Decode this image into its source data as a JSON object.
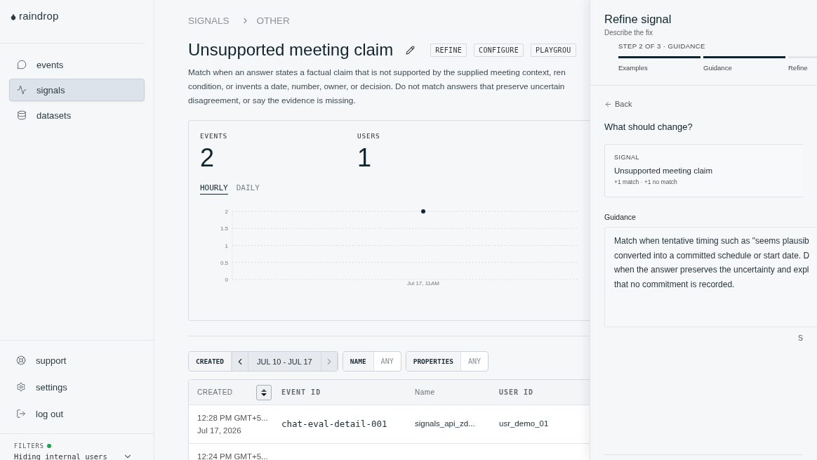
{
  "sidebar": {
    "logo": "raindrop",
    "nav": [
      {
        "label": "events",
        "selected": false
      },
      {
        "label": "signals",
        "selected": true
      },
      {
        "label": "datasets",
        "selected": false
      }
    ],
    "footer": [
      {
        "label": "support"
      },
      {
        "label": "settings"
      },
      {
        "label": "log out"
      }
    ],
    "filters": {
      "label": "FILTERS",
      "active": true,
      "value": "Hiding internal users"
    }
  },
  "breadcrumb": [
    "SIGNALS",
    "OTHER"
  ],
  "signal": {
    "title": "Unsupported meeting claim",
    "actions": [
      "REFINE",
      "CONFIGURE",
      "PLAYGROU"
    ],
    "description": [
      "Match when an answer states a factual claim that is not supported by the supplied meeting context, ren",
      "condition, or invents a date, number, owner, or decision. Do not match answers that preserve uncertain",
      "disagreement, or say the evidence is missing."
    ]
  },
  "stats": [
    {
      "label": "EVENTS",
      "value": "2"
    },
    {
      "label": "USERS",
      "value": "1"
    }
  ],
  "range_tabs": [
    {
      "label": "HOURLY",
      "selected": true
    },
    {
      "label": "DAILY",
      "selected": false
    }
  ],
  "chart_data": {
    "type": "line",
    "categories": [
      "Jul 17, 11AM"
    ],
    "grid": true,
    "series": [
      {
        "color": "#0f2a33",
        "marker": true,
        "values": [
          2
        ]
      }
    ],
    "ylim": [
      0,
      2
    ],
    "yticks": [
      0,
      {
        "value": 0.5,
        "label": "0.5"
      },
      1,
      {
        "value": 1.5,
        "label": "1.5"
      },
      2
    ]
  },
  "filter_bar": [
    {
      "kind": "range",
      "label": "CREATED",
      "value": "JUL 10 - JUL 17"
    },
    {
      "kind": "pick",
      "label": "NAME",
      "value": "ANY"
    },
    {
      "kind": "pick",
      "label": "PROPERTIES",
      "value": "ANY"
    }
  ],
  "table": {
    "columns": [
      {
        "label": "CREATED",
        "kind": "sortable"
      },
      {
        "label": "EVENT ID",
        "kind": "mono"
      },
      {
        "label": "Name",
        "kind": "plain"
      },
      {
        "label": "USER ID",
        "kind": "mono"
      }
    ],
    "rows": [
      {
        "created": "12:28 PM GMT+5...",
        "date": "Jul 17, 2026",
        "event_id": "chat-eval-detail-001",
        "name": "signals_api_zd...",
        "user_id": "usr_demo_01"
      },
      {
        "created": "12:24 PM GMT+5..."
      }
    ]
  },
  "panel": {
    "title": "Refine signal",
    "subtitle": "Describe the fix",
    "step": "STEP 2 OF 3",
    "step_separator": "·",
    "step_name": "GUIDANCE",
    "steps": [
      {
        "label": "Examples",
        "done": true
      },
      {
        "label": "Guidance",
        "done": true
      },
      {
        "label": "Refine",
        "done": false
      }
    ],
    "back": "Back",
    "heading": "What should change?",
    "signal_card": {
      "label": "SIGNAL",
      "name": "Unsupported meeting claim",
      "meta": "+1 match · +1 no match"
    },
    "guidance_label": "Guidance",
    "guidance": [
      "Match when tentative timing such as \"seems plausib",
      "converted into a committed schedule or start date. D",
      "when the answer preserves the uncertainty and expl",
      "that no commitment is recorded."
    ],
    "footer_text": "S"
  }
}
